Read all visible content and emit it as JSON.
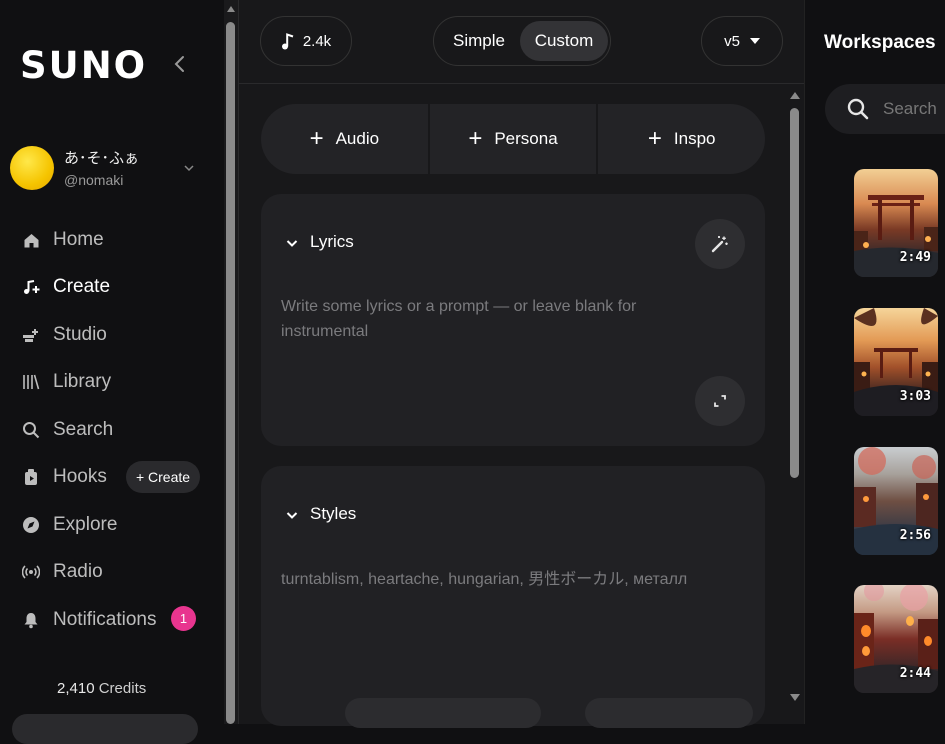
{
  "app": {
    "logo": "SUNO"
  },
  "user": {
    "name": "あ･そ･ふぁ",
    "handle": "@nomaki"
  },
  "sidebar": {
    "items": [
      {
        "label": "Home",
        "icon": "home-icon"
      },
      {
        "label": "Create",
        "icon": "create-music-icon"
      },
      {
        "label": "Studio",
        "icon": "studio-icon"
      },
      {
        "label": "Library",
        "icon": "library-icon"
      },
      {
        "label": "Search",
        "icon": "search-icon"
      },
      {
        "label": "Hooks",
        "icon": "hooks-icon"
      },
      {
        "label": "Explore",
        "icon": "compass-icon"
      },
      {
        "label": "Radio",
        "icon": "radio-icon"
      },
      {
        "label": "Notifications",
        "icon": "bell-icon"
      }
    ],
    "hooks_create_label": "+ Create",
    "notifications_count": "1",
    "credits_value": "2,410",
    "credits_label": "Credits"
  },
  "topbar": {
    "count": "2.4k",
    "mode_simple": "Simple",
    "mode_custom": "Custom",
    "selected_mode": "Custom",
    "version": "v5"
  },
  "add_buttons": {
    "audio": "Audio",
    "persona": "Persona",
    "inspo": "Inspo"
  },
  "lyrics": {
    "label": "Lyrics",
    "placeholder_line1": "Write some lyrics or a prompt — or leave blank for",
    "placeholder_line2": "instrumental"
  },
  "styles": {
    "label": "Styles",
    "placeholder": "turntablism, heartache, hungarian, 男性ボーカル, металл"
  },
  "workspaces": {
    "title": "Workspaces",
    "search_placeholder": "Search",
    "thumbs": [
      {
        "duration": "2:49"
      },
      {
        "duration": "3:03"
      },
      {
        "duration": "2:56"
      },
      {
        "duration": "2:44"
      }
    ]
  },
  "colors": {
    "background": "#101012",
    "panel": "#18181a",
    "card": "#212124",
    "badge": "#e8358f",
    "avatar": "#f5c400"
  }
}
